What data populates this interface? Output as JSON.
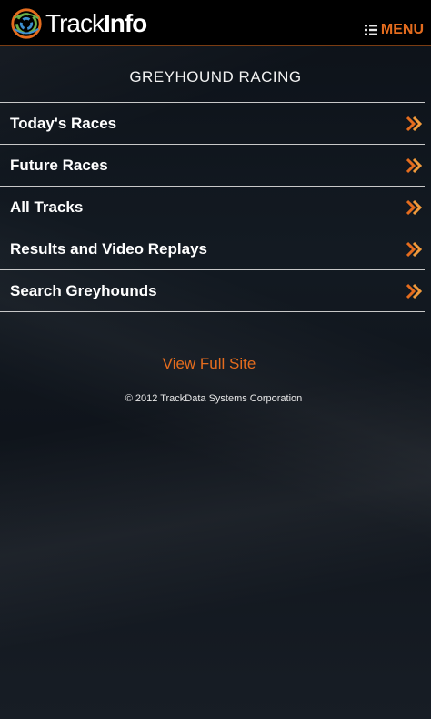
{
  "header": {
    "logo_text_light": "Track",
    "logo_text_bold": "Info",
    "menu_label": "MENU"
  },
  "page": {
    "title": "GREYHOUND RACING"
  },
  "nav": {
    "items": [
      {
        "label": "Today's Races",
        "icon": "double-chevron-right-icon"
      },
      {
        "label": "Future Races",
        "icon": "double-chevron-right-icon"
      },
      {
        "label": "All Tracks",
        "icon": "double-chevron-right-icon"
      },
      {
        "label": "Results and Video Replays",
        "icon": "double-chevron-right-icon"
      },
      {
        "label": "Search Greyhounds",
        "icon": "double-chevron-right-icon"
      }
    ]
  },
  "footer": {
    "full_site_label": "View Full Site",
    "copyright": "© 2012  TrackData Systems Corporation"
  },
  "colors": {
    "accent": "#e46c1e",
    "header_bg": "#000000",
    "divider": "#c8c8c8"
  }
}
